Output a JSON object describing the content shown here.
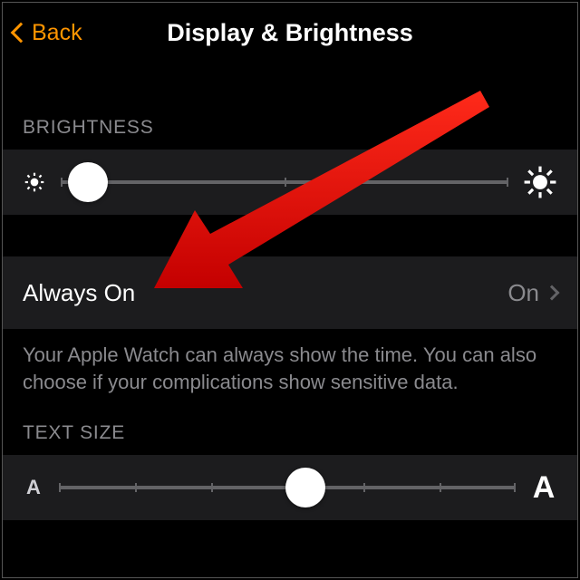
{
  "nav": {
    "back_label": "Back",
    "title": "Display & Brightness"
  },
  "brightness": {
    "header": "BRIGHTNESS",
    "icon_small": "sun-small-icon",
    "icon_large": "sun-large-icon",
    "value_percent": 6,
    "ticks": [
      0,
      50,
      100
    ]
  },
  "always_on": {
    "label": "Always On",
    "value": "On",
    "description": "Your Apple Watch can always show the time. You can also choose if your complications show sensitive data."
  },
  "text_size": {
    "header": "TEXT SIZE",
    "small_glyph": "A",
    "large_glyph": "A",
    "value_percent": 54,
    "ticks": [
      0,
      17,
      33,
      50,
      67,
      83,
      100
    ]
  },
  "colors": {
    "accent": "#ff9500",
    "cell": "#1c1c1e",
    "text_secondary": "#8a8a8e",
    "slider": "#636366",
    "annotation_arrow": "#e80000"
  }
}
